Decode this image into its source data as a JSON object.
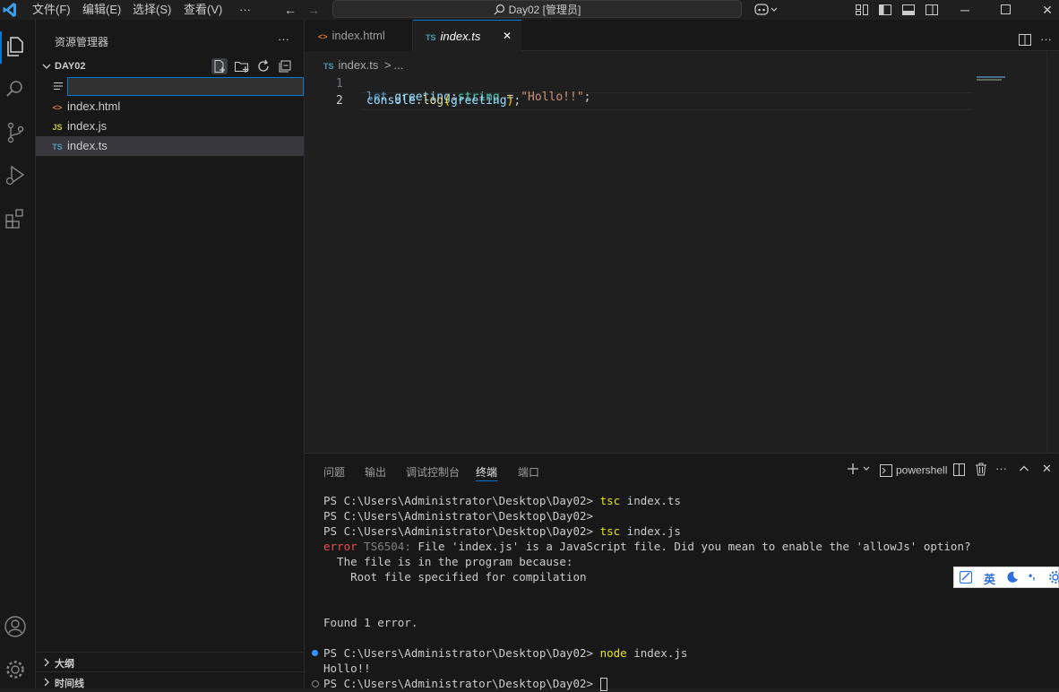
{
  "titlebar": {
    "menus": [
      "文件(F)",
      "编辑(E)",
      "选择(S)",
      "查看(V)",
      "···"
    ],
    "search_text": "Day02 [管理员]"
  },
  "explorer": {
    "title": "资源管理器",
    "more": "···",
    "folder": "DAY02",
    "new_file_value": "",
    "files": [
      {
        "name": "index.html",
        "icon": "<>",
        "icon_color": "#e37933"
      },
      {
        "name": "index.js",
        "icon": "JS",
        "icon_color": "#cbcb41"
      },
      {
        "name": "index.ts",
        "icon": "TS",
        "icon_color": "#519aba"
      }
    ],
    "outline": "大纲",
    "timeline": "时间线"
  },
  "tabs": [
    {
      "label": "index.html",
      "icon": "<>",
      "icon_color": "#e37933"
    },
    {
      "label": "index.ts",
      "icon": "TS",
      "icon_color": "#519aba"
    }
  ],
  "breadcrumb": {
    "file": "index.ts",
    "sep": ">",
    "more": "..."
  },
  "code": {
    "line_numbers": [
      "1",
      "2"
    ],
    "line1": {
      "kw": "let",
      "var": "greeting",
      "colon": ":",
      "type": "string",
      "eq": " = ",
      "str": "\"Hollo!!\"",
      "semi": ";"
    },
    "line2": {
      "obj": "console",
      "dot": ".",
      "fn": "log",
      "open": "(",
      "arg": "greeting",
      "close": ")",
      "semi": ";"
    }
  },
  "panel": {
    "tabs": [
      "问题",
      "输出",
      "调试控制台",
      "终端",
      "端口"
    ],
    "shell": "powershell",
    "more": "···"
  },
  "terminal": {
    "prompt": "PS C:\\Users\\Administrator\\Desktop\\Day02>",
    "cmd1": "tsc",
    "arg1": "index.ts",
    "cmd2": "tsc",
    "arg2": "index.js",
    "err_word": "error",
    "err_code": "TS6504:",
    "err_msg": "File 'index.js' is a JavaScript file. Did you mean to enable the 'allowJs' option?",
    "err_line2": "  The file is in the program because:",
    "err_line3": "    Root file specified for compilation",
    "found": "Found 1 error.",
    "cmd3": "node",
    "arg3": "index.js",
    "output": "Hollo!!"
  },
  "ime": {
    "lang": "英",
    "punct": "•,"
  },
  "colors": {
    "accent": "#0078d4",
    "keyword": "#569cd6",
    "variable": "#9cdcfe",
    "type": "#4ec9b0",
    "string": "#ce9178",
    "function": "#dcdcaa",
    "error": "#f14c4c",
    "cmd": "#e5e510"
  }
}
